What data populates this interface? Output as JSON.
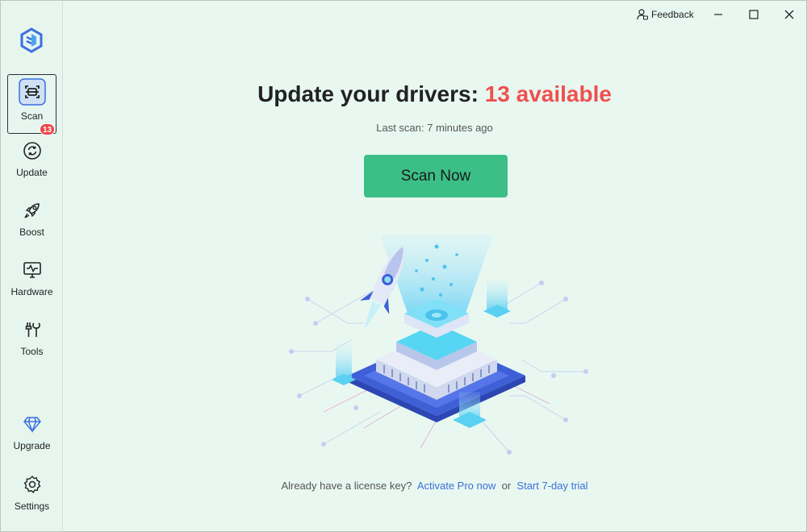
{
  "sidebar": {
    "items": [
      {
        "label": "Scan",
        "icon": "scan-icon",
        "active": true,
        "badge": "13"
      },
      {
        "label": "Update",
        "icon": "update-icon"
      },
      {
        "label": "Boost",
        "icon": "rocket-icon"
      },
      {
        "label": "Hardware",
        "icon": "monitor-pulse-icon"
      },
      {
        "label": "Tools",
        "icon": "tools-icon"
      },
      {
        "label": "Upgrade",
        "icon": "diamond-icon"
      },
      {
        "label": "Settings",
        "icon": "gear-icon"
      }
    ]
  },
  "titlebar": {
    "feedback_label": "Feedback"
  },
  "main": {
    "headline_prefix": "Update your drivers: ",
    "headline_count": "13 available",
    "last_scan": "Last scan: 7 minutes ago",
    "scan_button": "Scan Now",
    "license_text": "Already have a license key?",
    "activate_link": "Activate Pro now",
    "or_text": "or",
    "trial_link": "Start 7-day trial"
  },
  "colors": {
    "accent": "#3cbf87",
    "highlight": "#ef5050",
    "link": "#3a6fd8",
    "background": "#e9f8f2"
  }
}
